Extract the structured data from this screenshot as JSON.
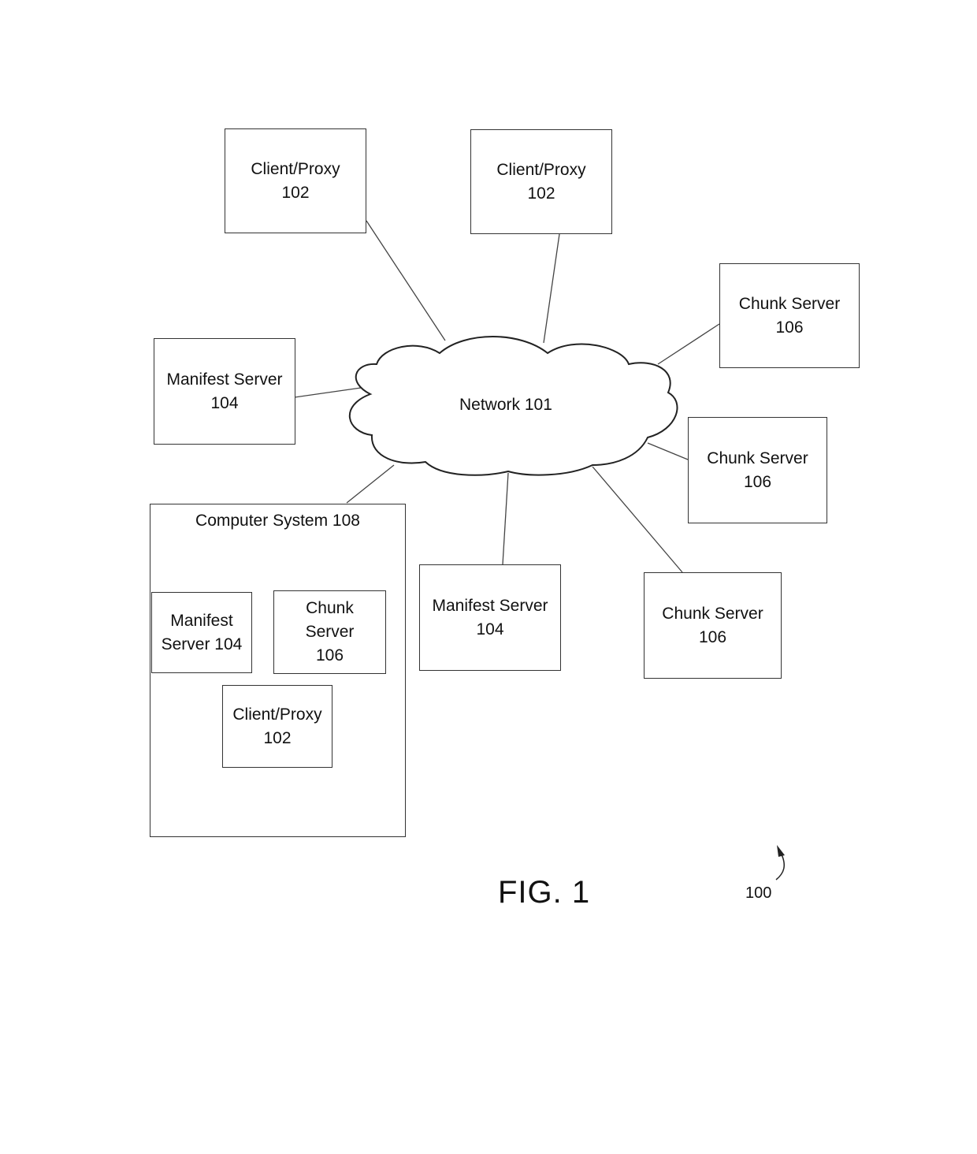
{
  "figure": {
    "title": "FIG. 1",
    "reference": "100"
  },
  "network": {
    "label": "Network 101"
  },
  "nodes": {
    "client_proxy_1": "Client/Proxy\n102",
    "client_proxy_2": "Client/Proxy\n102",
    "chunk_server_1": "Chunk Server\n106",
    "chunk_server_2": "Chunk Server\n106",
    "chunk_server_3": "Chunk Server\n106",
    "manifest_server_1": "Manifest Server\n104",
    "manifest_server_2": "Manifest Server\n104"
  },
  "computer_system": {
    "label": "Computer System 108",
    "manifest_server": "Manifest\nServer 104",
    "chunk_server": "Chunk\nServer\n106",
    "client_proxy": "Client/Proxy\n102"
  }
}
